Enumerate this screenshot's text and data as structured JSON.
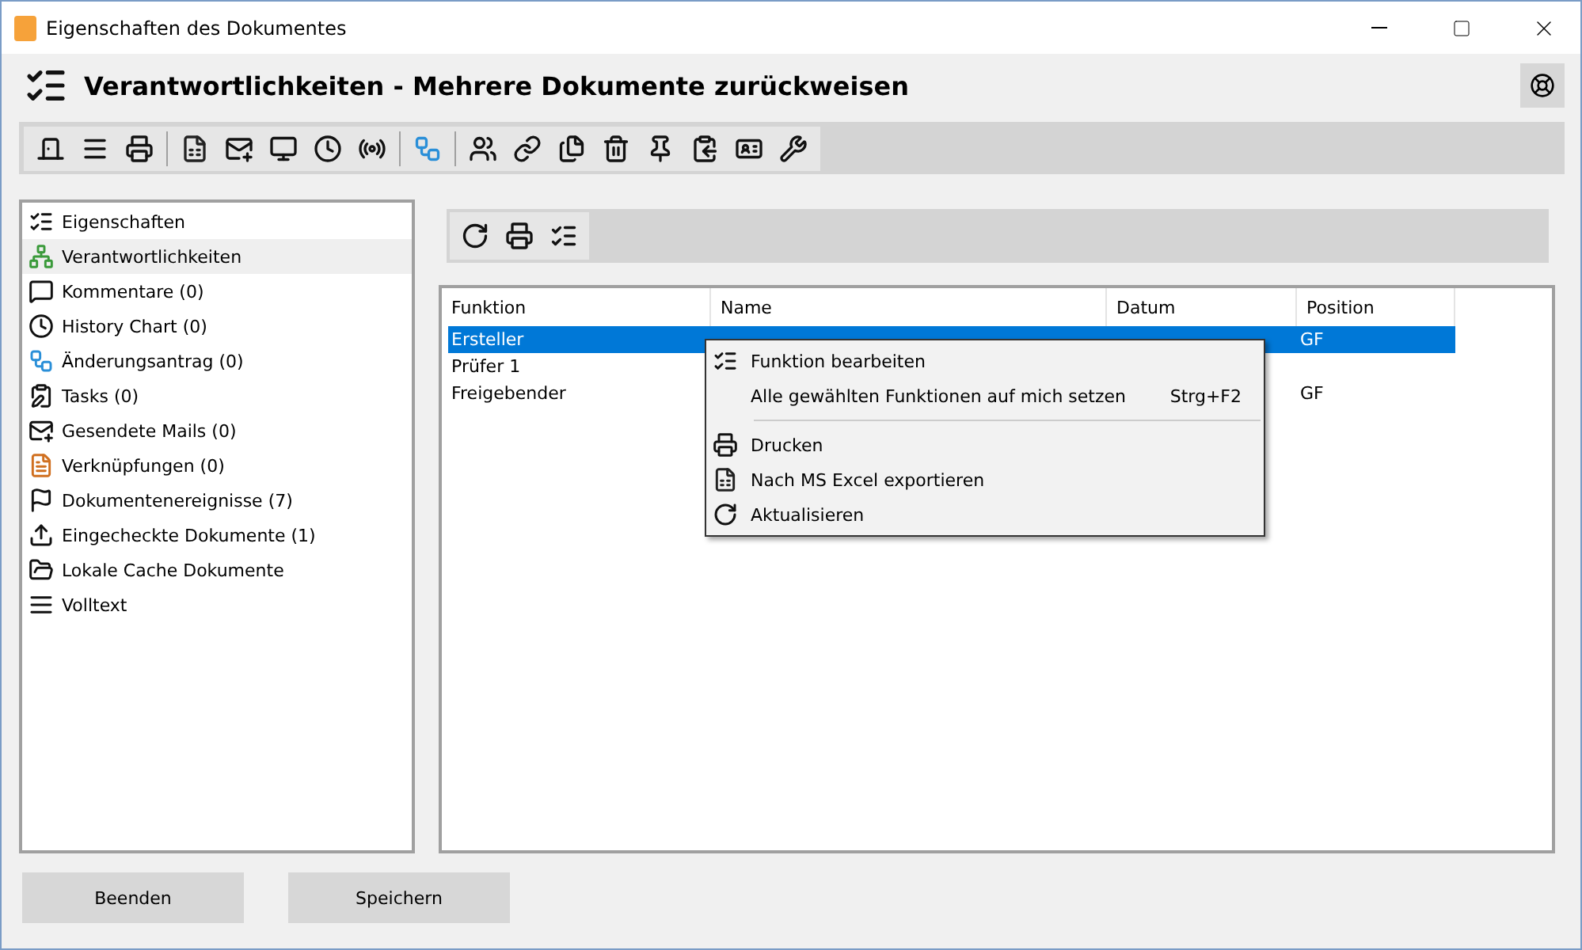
{
  "window": {
    "title": "Eigenschaften des Dokumentes"
  },
  "header": {
    "title": "Verantwortlichkeiten - Mehrere Dokumente zurückweisen"
  },
  "sidebar": {
    "items": [
      {
        "label": "Eigenschaften",
        "selected": false
      },
      {
        "label": "Verantwortlichkeiten",
        "selected": true
      },
      {
        "label": "Kommentare (0)",
        "selected": false
      },
      {
        "label": "History Chart (0)",
        "selected": false
      },
      {
        "label": "Änderungsantrag (0)",
        "selected": false
      },
      {
        "label": "Tasks (0)",
        "selected": false
      },
      {
        "label": "Gesendete Mails (0)",
        "selected": false
      },
      {
        "label": "Verknüpfungen (0)",
        "selected": false
      },
      {
        "label": "Dokumentenereignisse (7)",
        "selected": false
      },
      {
        "label": "Eingecheckte Dokumente (1)",
        "selected": false
      },
      {
        "label": "Lokale Cache Dokumente",
        "selected": false
      },
      {
        "label": "Volltext",
        "selected": false
      }
    ]
  },
  "table": {
    "columns": [
      "Funktion",
      "Name",
      "Datum",
      "Position"
    ],
    "rows": [
      {
        "cells": [
          "Ersteller",
          "",
          "",
          "GF"
        ],
        "selected": true
      },
      {
        "cells": [
          "Prüfer 1",
          "",
          "",
          ""
        ],
        "selected": false
      },
      {
        "cells": [
          "Freigebender",
          "",
          "",
          "GF"
        ],
        "selected": false
      }
    ]
  },
  "context_menu": {
    "items": [
      {
        "kind": "item",
        "label": "Funktion bearbeiten"
      },
      {
        "kind": "item",
        "label": "Alle gewählten Funktionen auf mich setzen",
        "shortcut": "Strg+F2"
      },
      {
        "kind": "separator"
      },
      {
        "kind": "item",
        "label": "Drucken"
      },
      {
        "kind": "item",
        "label": "Nach MS Excel exportieren"
      },
      {
        "kind": "item",
        "label": "Aktualisieren"
      }
    ]
  },
  "buttons": [
    "Beenden",
    "Speichern"
  ]
}
